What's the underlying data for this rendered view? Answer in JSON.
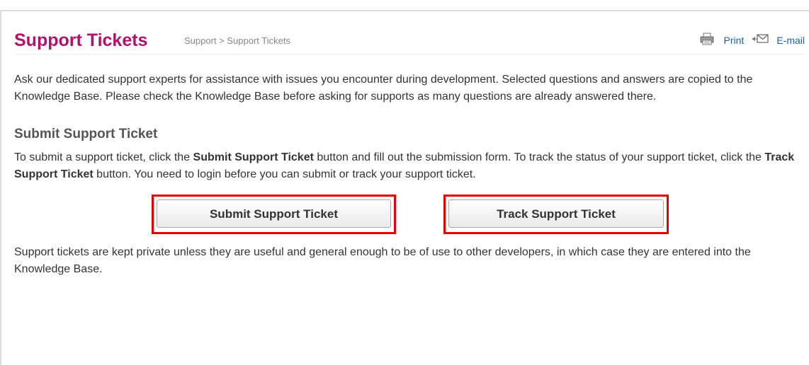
{
  "header": {
    "title": "Support Tickets",
    "breadcrumb": [
      "Support",
      ">",
      "Support Tickets"
    ],
    "print_label": "Print",
    "email_label": "E-mail"
  },
  "intro_text": "Ask our dedicated support experts for assistance with issues you encounter during development. Selected questions and answers are copied to the Knowledge Base. Please check the Knowledge Base before asking for supports as many questions are already answered there.",
  "section": {
    "title": "Submit Support Ticket",
    "instructions": {
      "part1": "To submit a support ticket, click the ",
      "bold1": "Submit Support Ticket",
      "part2": " button and fill out the submission form. To track the status of your support ticket, click the ",
      "bold2": "Track Support Ticket",
      "part3": " button. You need to login before you can submit or track your support ticket."
    },
    "submit_button": "Submit Support Ticket",
    "track_button": "Track Support Ticket",
    "footer_text": "Support tickets are kept private unless they are useful and general enough to be of use to other developers, in which case they are entered into the Knowledge Base."
  },
  "colors": {
    "title": "#b0126a",
    "link": "#1f5fa8",
    "highlight_border": "#e60000"
  },
  "icons": {
    "print": "printer-icon",
    "email": "envelope-icon"
  }
}
